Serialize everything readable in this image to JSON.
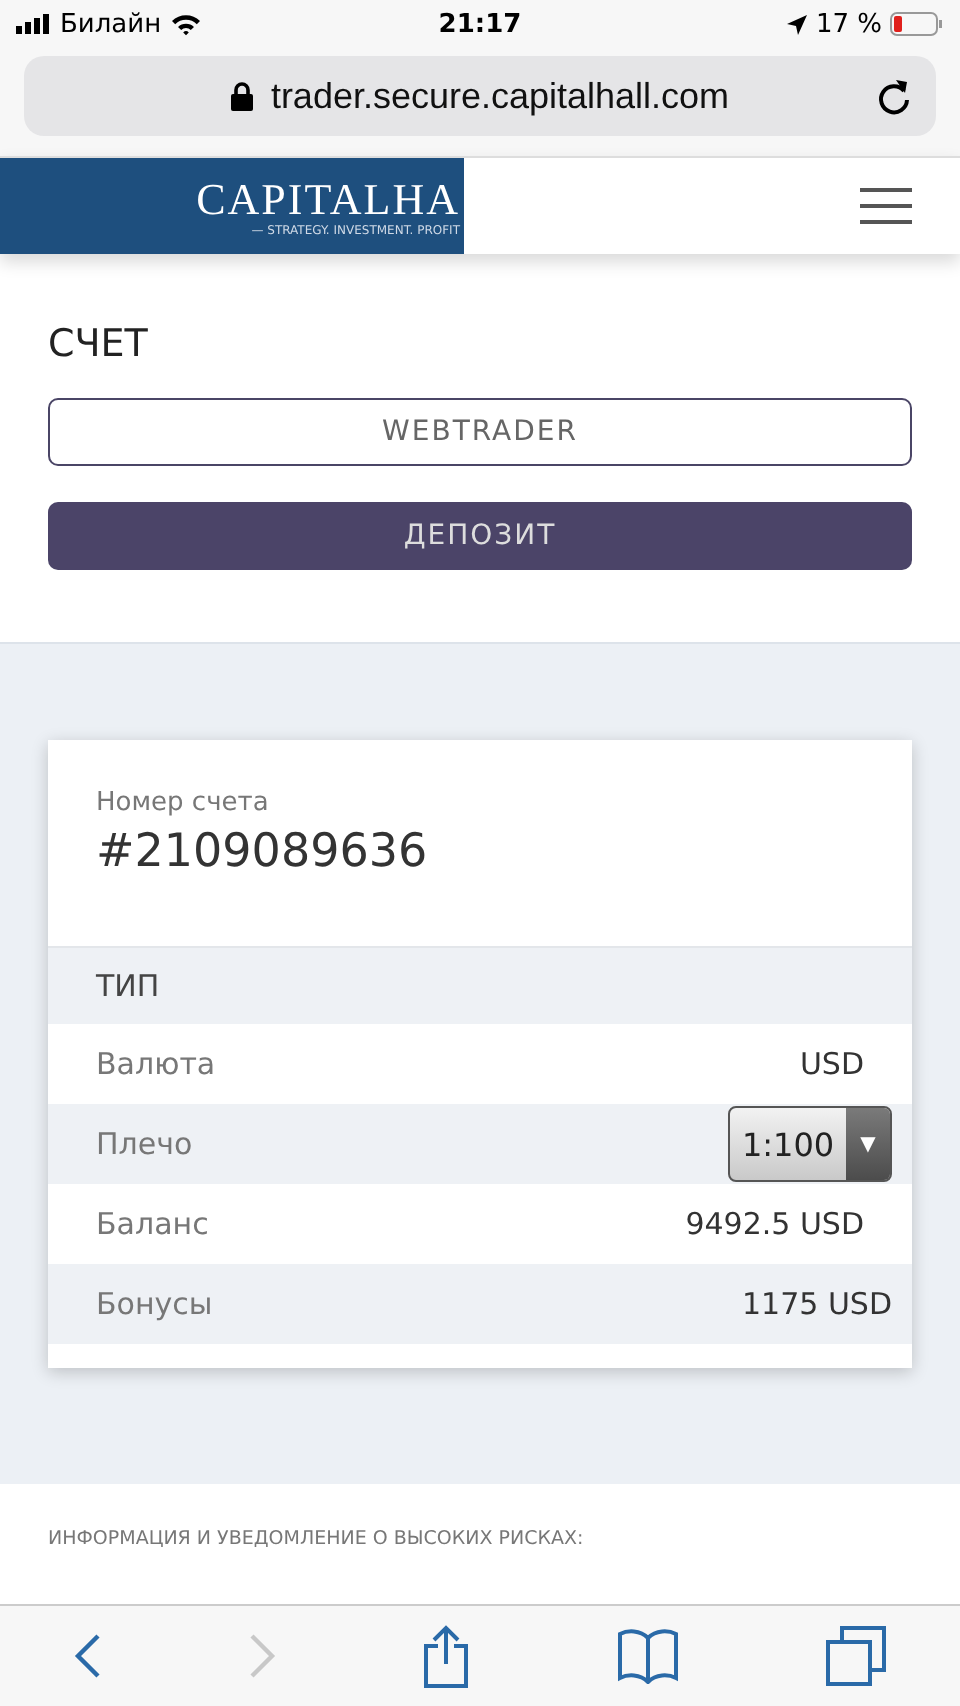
{
  "status_bar": {
    "carrier": "Билайн",
    "time": "21:17",
    "battery": "17 %"
  },
  "address_bar": {
    "url": "trader.secure.capitalhall.com"
  },
  "header": {
    "logo": "CAPITALHA",
    "tagline": "— STRATEGY. INVESTMENT. PROFIT"
  },
  "account_section": {
    "title": "СЧЕТ",
    "buttons": [
      {
        "label": "WEBTRADER",
        "kind": "outline"
      },
      {
        "label": "ДЕПОЗИТ",
        "kind": "filled"
      }
    ]
  },
  "account_card": {
    "number_label": "Номер счета",
    "number": "#2109089636",
    "section_title": "ТИП",
    "rows": [
      {
        "label": "Валюта",
        "kind": "text",
        "value": "USD"
      },
      {
        "label": "Плечо",
        "kind": "select",
        "value": "1:100",
        "arrow": "▼"
      },
      {
        "label": "Баланс",
        "kind": "text",
        "value": "9492.5 USD"
      },
      {
        "label": "Бонусы",
        "kind": "text",
        "value": "1175 USD"
      }
    ]
  },
  "disclaimer": {
    "title": "ИНФОРМАЦИЯ И УВЕДОМЛЕНИЕ О ВЫСОКИХ РИСКАХ:"
  },
  "toolbar": [
    {
      "kind": "back",
      "disabled": false
    },
    {
      "kind": "forward",
      "disabled": true
    },
    {
      "kind": "share",
      "disabled": false
    },
    {
      "kind": "bookmarks",
      "disabled": false
    },
    {
      "kind": "tabs",
      "disabled": false
    }
  ]
}
